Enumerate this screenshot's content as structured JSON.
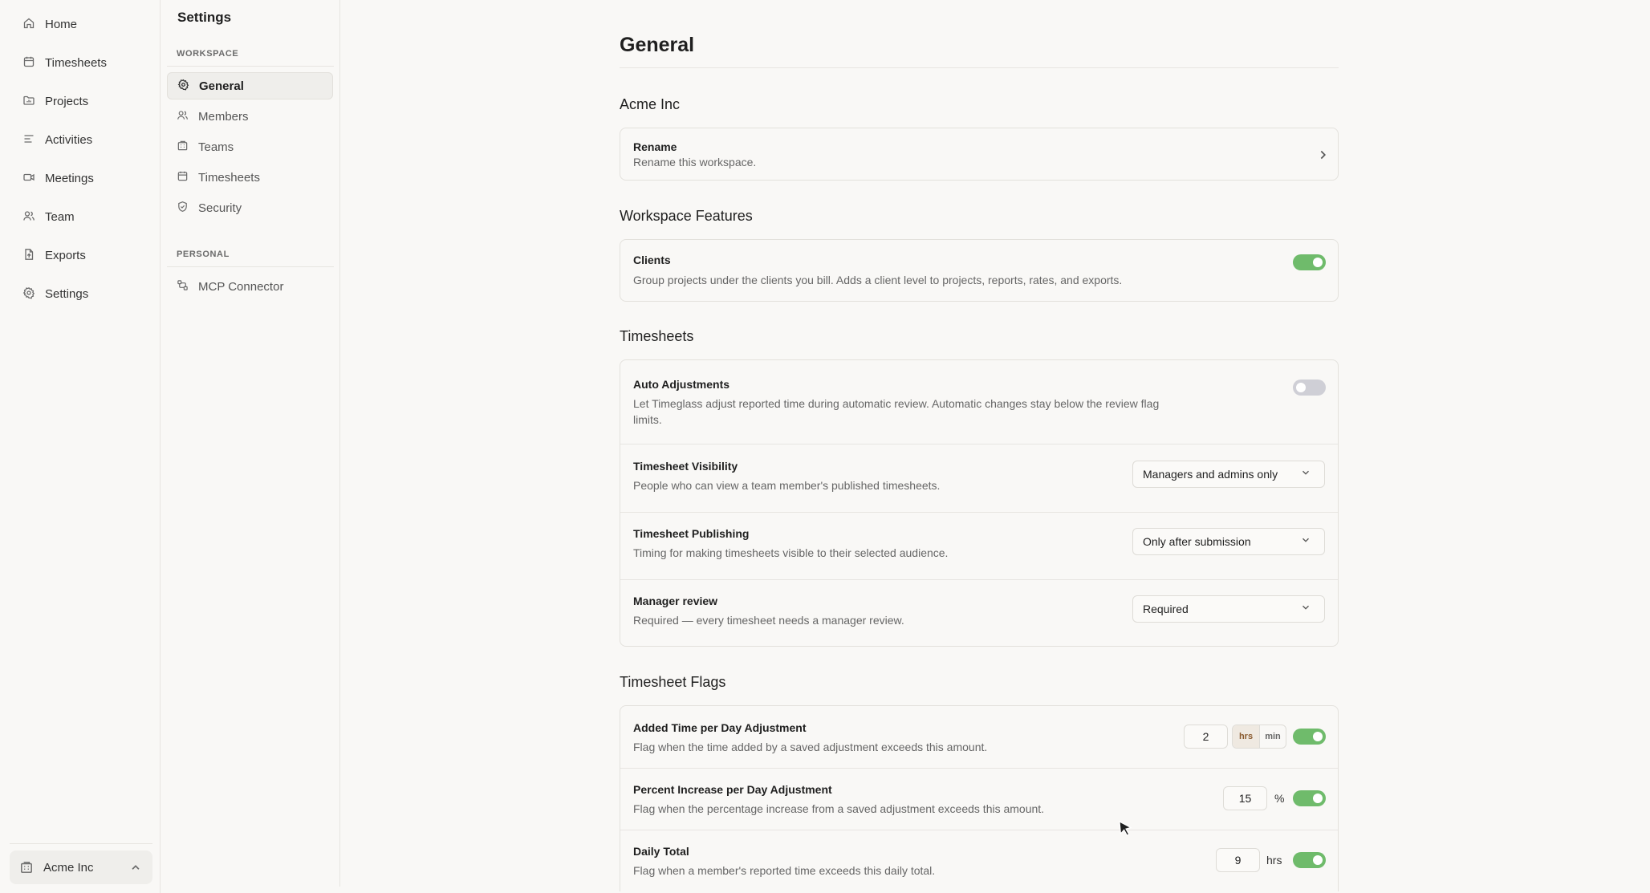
{
  "nav": {
    "items": [
      {
        "label": "Home",
        "icon": "home-icon"
      },
      {
        "label": "Timesheets",
        "icon": "calendar-icon"
      },
      {
        "label": "Projects",
        "icon": "folder-icon"
      },
      {
        "label": "Activities",
        "icon": "list-icon"
      },
      {
        "label": "Meetings",
        "icon": "video-icon"
      },
      {
        "label": "Team",
        "icon": "users-icon"
      },
      {
        "label": "Exports",
        "icon": "file-export-icon"
      },
      {
        "label": "Settings",
        "icon": "gear-icon"
      }
    ],
    "workspace_switcher": {
      "label": "Acme Inc",
      "icon": "building-icon"
    }
  },
  "settings_sidebar": {
    "title": "Settings",
    "workspace_heading": "WORKSPACE",
    "workspace_items": [
      {
        "label": "General",
        "icon": "gear-icon",
        "active": true
      },
      {
        "label": "Members",
        "icon": "users-icon"
      },
      {
        "label": "Teams",
        "icon": "building-icon"
      },
      {
        "label": "Timesheets",
        "icon": "calendar-icon"
      },
      {
        "label": "Security",
        "icon": "shield-icon"
      }
    ],
    "personal_heading": "PERSONAL",
    "personal_items": [
      {
        "label": "MCP Connector",
        "icon": "connector-icon"
      }
    ]
  },
  "main": {
    "title": "General",
    "workspace_section": {
      "title": "Acme Inc",
      "rename": {
        "title": "Rename",
        "description": "Rename this workspace."
      }
    },
    "features_section": {
      "title": "Workspace Features",
      "clients": {
        "title": "Clients",
        "description": "Group projects under the clients you bill. Adds a client level to projects, reports, rates, and exports.",
        "enabled": true
      }
    },
    "timesheets_section": {
      "title": "Timesheets",
      "auto_adjustments": {
        "title": "Auto Adjustments",
        "description": "Let Timeglass adjust reported time during automatic review. Automatic changes stay below the review flag limits.",
        "enabled": false
      },
      "visibility": {
        "title": "Timesheet Visibility",
        "description": "People who can view a team member's published timesheets.",
        "value": "Managers and admins only"
      },
      "publishing": {
        "title": "Timesheet Publishing",
        "description": "Timing for making timesheets visible to their selected audience.",
        "value": "Only after submission"
      },
      "manager_review": {
        "title": "Manager review",
        "description": "Required — every timesheet needs a manager review.",
        "value": "Required"
      }
    },
    "flags_section": {
      "title": "Timesheet Flags",
      "added_time": {
        "title": "Added Time per Day Adjustment",
        "description": "Flag when the time added by a saved adjustment exceeds this amount.",
        "value": "2",
        "unit_hrs": "hrs",
        "unit_min": "min",
        "selected_unit": "hrs",
        "enabled": true
      },
      "percent_increase": {
        "title": "Percent Increase per Day Adjustment",
        "description": "Flag when the percentage increase from a saved adjustment exceeds this amount.",
        "value": "15",
        "unit": "%",
        "enabled": true
      },
      "daily_total": {
        "title": "Daily Total",
        "description": "Flag when a member's reported time exceeds this daily total.",
        "value": "9",
        "unit": "hrs",
        "enabled": true
      }
    }
  },
  "colors": {
    "toggle_on": "#6fbb6b",
    "toggle_off": "#cfcfd6",
    "background": "#f9f8f6",
    "unit_selected": "#8a5a2e"
  }
}
